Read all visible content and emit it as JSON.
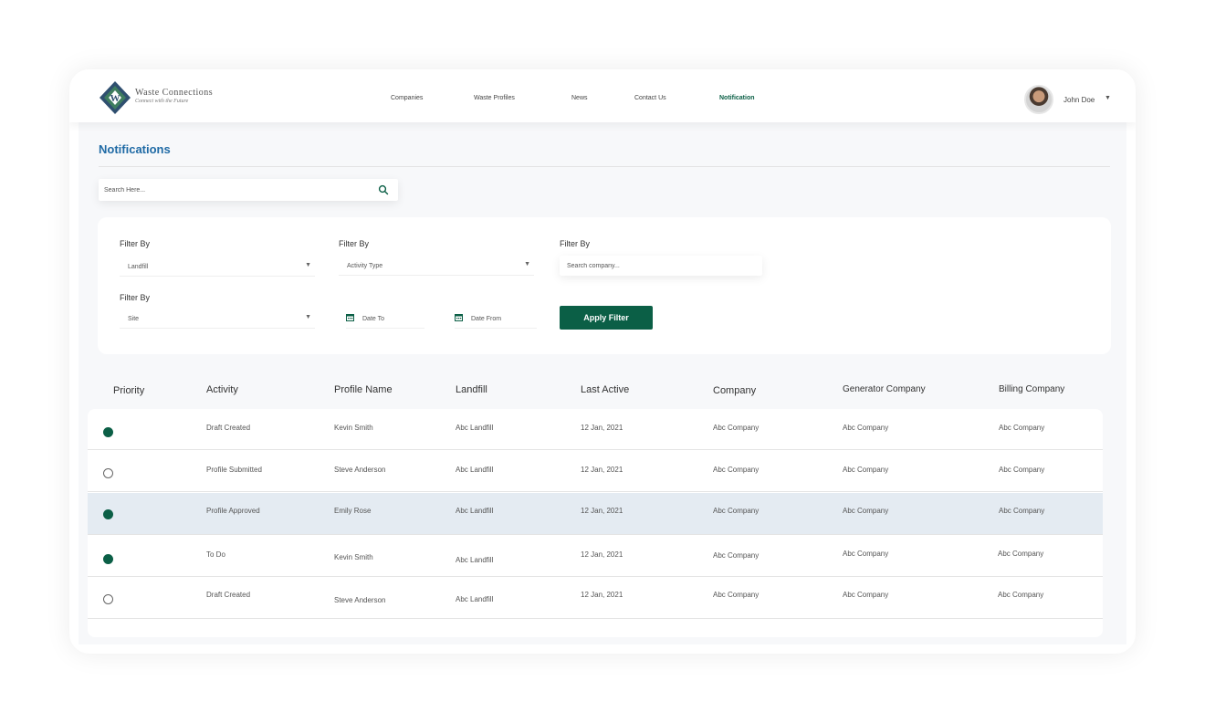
{
  "brand": {
    "name": "Waste Connections",
    "tagline": "Connect with the Future"
  },
  "nav": {
    "items": [
      "Companies",
      "Waste Profiles",
      "News",
      "Contact Us",
      "Notification"
    ],
    "active": "Notification"
  },
  "user": {
    "name": "John Doe"
  },
  "page": {
    "title": "Notifications"
  },
  "search": {
    "placeholder": "Search Here..."
  },
  "filters": {
    "label": "Filter By",
    "landfill": "Landfill",
    "activity_type": "Activity Type",
    "company_placeholder": "Search company...",
    "site": "Site",
    "date_to": "Date To",
    "date_from": "Date From",
    "apply_label": "Apply Filter"
  },
  "table": {
    "headers": [
      "Priority",
      "Activity",
      "Profile Name",
      "Landfill",
      "Last Active",
      "Company",
      "Generator Company",
      "Billing Company"
    ],
    "rows": [
      {
        "priority": "filled",
        "activity": "Draft Created",
        "profile": "Kevin Smith",
        "landfill": "Abc Landfill",
        "last_active": "12 Jan, 2021",
        "company": "Abc Company",
        "generator": "Abc Company",
        "billing": "Abc Company"
      },
      {
        "priority": "empty",
        "activity": "Profile Submitted",
        "profile": "Steve Anderson",
        "landfill": "Abc Landfill",
        "last_active": "12 Jan, 2021",
        "company": "Abc Company",
        "generator": "Abc Company",
        "billing": "Abc Company"
      },
      {
        "priority": "filled",
        "activity": "Profile Approved",
        "profile": "Emily Rose",
        "landfill": "Abc Landfill",
        "last_active": "12 Jan, 2021",
        "company": "Abc Company",
        "generator": "Abc Company",
        "billing": "Abc Company"
      },
      {
        "priority": "filled",
        "activity": "To Do",
        "profile": "Kevin Smith",
        "landfill": "Abc Landfill",
        "last_active": "12 Jan, 2021",
        "company": "Abc Company",
        "generator": "Abc Company",
        "billing": "Abc Company"
      },
      {
        "priority": "empty",
        "activity": "Draft Created",
        "profile": "Steve Anderson",
        "landfill": "Abc Landfill",
        "last_active": "12 Jan, 2021",
        "company": "Abc Company",
        "generator": "Abc Company",
        "billing": "Abc Company"
      }
    ]
  },
  "colors": {
    "primary": "#0b5f46",
    "title": "#1f6aa5",
    "highlight_row": "#e4ebf2"
  },
  "icons": {
    "search": "search-icon",
    "calendar": "calendar-icon",
    "caret": "chevron-down-icon"
  }
}
